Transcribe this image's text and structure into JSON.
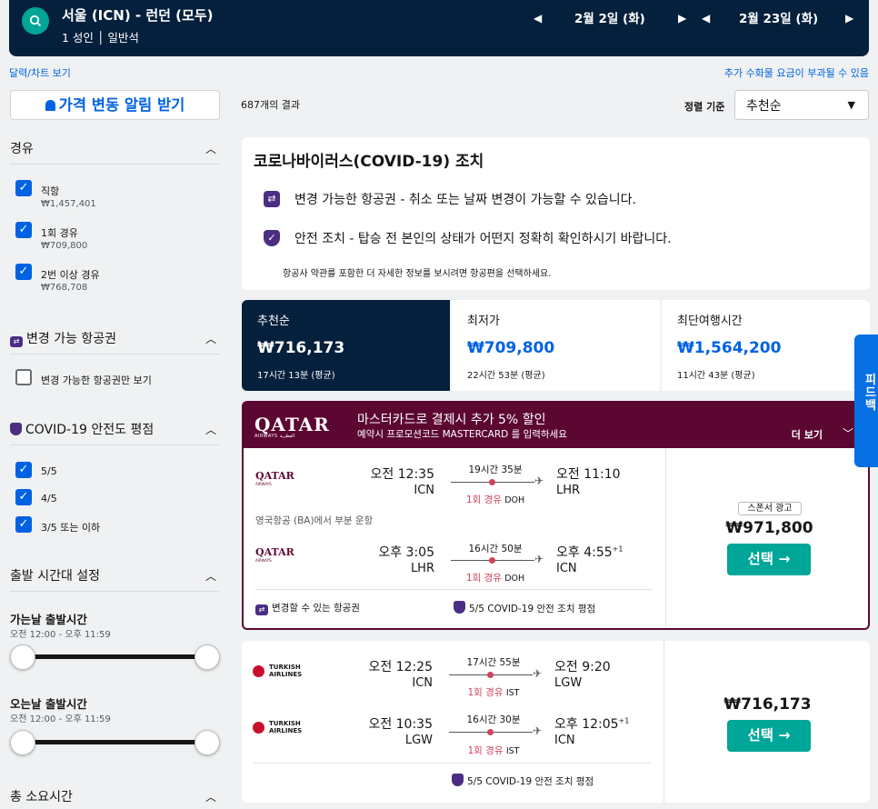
{
  "header": {
    "route": "서울 (ICN) - 런던 (모두)",
    "passengers": "1 성인 │ 일반석",
    "depart_date": "2월 2일 (화)",
    "return_date": "2월 23일 (화)"
  },
  "links": {
    "calendar": "달력/차트 보기",
    "fees_note": "추가 수화물 요금이 부과될 수 있음"
  },
  "sidebar": {
    "alert_button": "가격 변동 알림 받기",
    "stops": {
      "title": "경유",
      "options": [
        {
          "label": "직항",
          "price": "₩1,457,401",
          "checked": true
        },
        {
          "label": "1회 경유",
          "price": "₩709,800",
          "checked": true
        },
        {
          "label": "2번 이상 경유",
          "price": "₩768,708",
          "checked": true
        }
      ]
    },
    "flex": {
      "title": "변경 가능 항공권",
      "option": "변경 가능한 항공권만 보기"
    },
    "covid": {
      "title": "COVID-19 안전도 평점",
      "options": [
        {
          "label": "5/5"
        },
        {
          "label": "4/5"
        },
        {
          "label": "3/5 또는 이하"
        }
      ]
    },
    "times": {
      "title": "출발 시간대 설정",
      "outbound_title": "가는날 출발시간",
      "outbound_range": "오전 12:00 - 오후 11:59",
      "inbound_title": "오는날 출발시간",
      "inbound_range": "오전 12:00 - 오후 11:59"
    },
    "duration_title": "총 소요시간"
  },
  "results": {
    "count": "687개의 결과",
    "sort_label": "정렬 기준",
    "sort_value": "추천순"
  },
  "covid_card": {
    "title": "코로나바이러스(COVID-19) 조치",
    "line1": "변경 가능한 항공권 - 취소 또는 날짜 변경이 가능할 수 있습니다.",
    "line2": "안전 조치 - 탑승 전 본인의 상태가 어떤지 정확히 확인하시기 바랍니다.",
    "note": "항공사 약관를 포함한 더 자세한 정보를 보시려면 항공편을 선택하세요."
  },
  "sort_tabs": [
    {
      "label": "추천순",
      "price": "₩716,173",
      "duration": "17시간 13분 (평균)"
    },
    {
      "label": "최저가",
      "price": "₩709,800",
      "duration": "22시간 53분 (평균)"
    },
    {
      "label": "최단여행시간",
      "price": "₩1,564,200",
      "duration": "11시간 43분 (평균)"
    }
  ],
  "qatar_banner": {
    "logo": "QATAR",
    "logo_sub": "AIRWAYS القطرية",
    "headline": "마스터카드로 결제시 추가 5% 할인",
    "subline": "예약시 프로모션코드 MASTERCARD 를 입력하세요",
    "more": "더 보기"
  },
  "flights": [
    {
      "airline": "QATAR",
      "airline_sub": "AIRWAYS",
      "out": {
        "dep_time": "오전 12:35",
        "dep_code": "ICN",
        "arr_time": "오전 11:10",
        "arr_code": "LHR",
        "duration": "19시간 35분",
        "stops": "1회 경유",
        "via": "DOH"
      },
      "operated": "영국항공 (BA)에서 부분 운항",
      "ret": {
        "dep_time": "오후 3:05",
        "dep_code": "LHR",
        "arr_time": "오후 4:55",
        "arr_plus": "+1",
        "arr_code": "ICN",
        "duration": "16시간 50분",
        "stops": "1회 경유",
        "via": "DOH"
      },
      "flex_label": "변경할 수 있는 항공권",
      "covid_label": "5/5 COVID-19 안전 조치 평점",
      "sponsor": "스폰서 광고",
      "price": "₩971,800",
      "select": "선택 →"
    },
    {
      "airline": "TURKISH AIRLINES",
      "out": {
        "dep_time": "오전 12:25",
        "dep_code": "ICN",
        "arr_time": "오전 9:20",
        "arr_code": "LGW",
        "duration": "17시간 55분",
        "stops": "1회 경유",
        "via": "IST"
      },
      "ret": {
        "dep_time": "오전 10:35",
        "dep_code": "LGW",
        "arr_time": "오후 12:05",
        "arr_plus": "+1",
        "arr_code": "ICN",
        "duration": "16시간 30분",
        "stops": "1회 경유",
        "via": "IST"
      },
      "covid_label": "5/5 COVID-19 안전 조치 평점",
      "price": "₩716,173",
      "select": "선택 →"
    }
  ],
  "feedback": "피드백",
  "colors": {
    "navy": "#05203c",
    "teal": "#00a698",
    "blue": "#0062e3",
    "qatar": "#5c0632"
  }
}
